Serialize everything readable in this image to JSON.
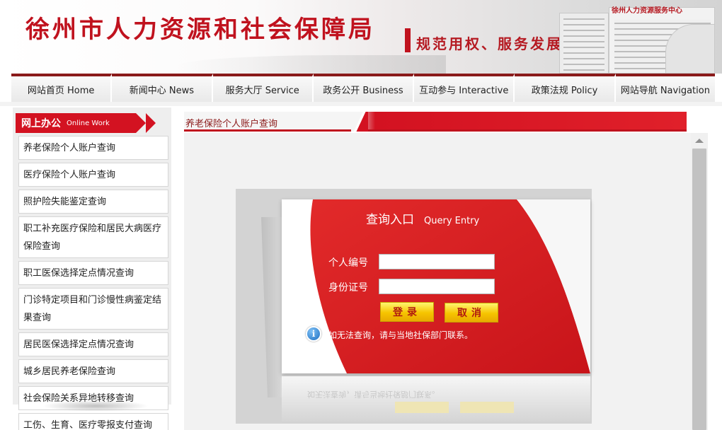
{
  "header": {
    "site_title": "徐州市人力资源和社会保障局",
    "slogan": "规范用权、服务发展",
    "building_label": "徐州人力资源服务中心"
  },
  "nav": {
    "items": [
      {
        "label": "网站首页 Home"
      },
      {
        "label": "新闻中心 News"
      },
      {
        "label": "服务大厅 Service"
      },
      {
        "label": "政务公开 Business"
      },
      {
        "label": "互动参与 Interactive"
      },
      {
        "label": "政策法规 Policy"
      },
      {
        "label": "网站导航 Navigation"
      }
    ]
  },
  "sidebar": {
    "title_zh": "网上办公",
    "title_en": "Online Work",
    "items": [
      {
        "label": "养老保险个人账户查询"
      },
      {
        "label": "医疗保险个人账户查询"
      },
      {
        "label": "照护险失能鉴定查询"
      },
      {
        "label": "职工补充医疗保险和居民大病医疗保险查询"
      },
      {
        "label": "职工医保选择定点情况查询"
      },
      {
        "label": "门诊特定项目和门诊慢性病鉴定结果查询"
      },
      {
        "label": "居民医保选择定点情况查询"
      },
      {
        "label": "城乡居民养老保险查询"
      },
      {
        "label": "社会保险关系异地转移查询"
      },
      {
        "label": "工伤、生育、医疗零报支付查询"
      }
    ]
  },
  "main": {
    "title": "养老保险个人账户查询"
  },
  "query": {
    "title_zh": "查询入口",
    "title_en": "Query Entry",
    "id_label": "个人编号",
    "id_value": "",
    "idcard_label": "身份证号",
    "idcard_value": "",
    "login_label": "登录",
    "cancel_label": "取消",
    "info_text": "如无法查询，请与当地社保部门联系。",
    "reflection_text": "如无法查询，请与当地社保部门联系。"
  },
  "colors": {
    "brand_red": "#d31221",
    "button_yellow": "#f6c400",
    "nav_border": "#8a1a1a"
  },
  "icons": {
    "info": "info-icon",
    "scroll_up": "chevron-up-icon"
  }
}
